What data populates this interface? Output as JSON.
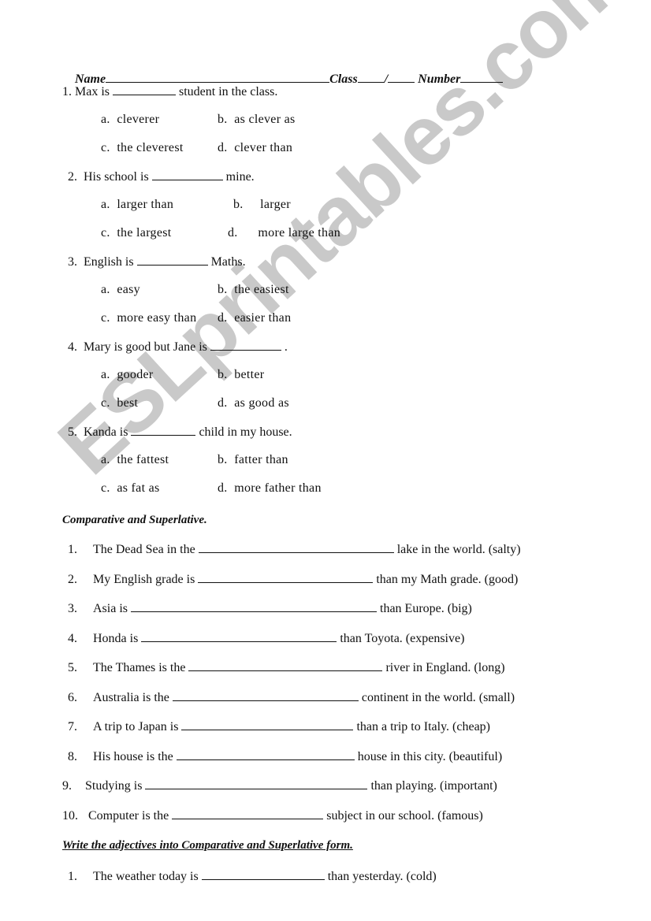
{
  "watermark": "ESLprintables.com",
  "header": {
    "name_label": "Name",
    "class_label": "Class",
    "class_separator": "/",
    "number_label": "Number"
  },
  "part1": {
    "questions": [
      {
        "num": "1.",
        "before": "Max is",
        "after": "student in the class.",
        "options": [
          {
            "letter": "a.",
            "text": "cleverer"
          },
          {
            "letter": "b.",
            "text": "as clever as"
          },
          {
            "letter": "c.",
            "text": "the cleverest"
          },
          {
            "letter": "d.",
            "text": "clever than"
          }
        ]
      },
      {
        "num": "2.",
        "before": "His school is",
        "after": "mine.",
        "options": [
          {
            "letter": "a.",
            "text": "larger than"
          },
          {
            "letter": "b.",
            "text": "larger"
          },
          {
            "letter": "c.",
            "text": "the largest"
          },
          {
            "letter": "d.",
            "text": "more large than"
          }
        ]
      },
      {
        "num": "3.",
        "before": "English is",
        "after": "Maths.",
        "options": [
          {
            "letter": "a.",
            "text": "easy"
          },
          {
            "letter": "b.",
            "text": "the easiest"
          },
          {
            "letter": "c.",
            "text": "more easy than"
          },
          {
            "letter": "d.",
            "text": "easier than"
          }
        ]
      },
      {
        "num": "4.",
        "before": "Mary is good but Jane is",
        "after": ".",
        "options": [
          {
            "letter": "a.",
            "text": "gooder"
          },
          {
            "letter": "b.",
            "text": "better"
          },
          {
            "letter": "c.",
            "text": "best"
          },
          {
            "letter": "d.",
            "text": "as good as"
          }
        ]
      },
      {
        "num": "5.",
        "before": "Kanda is",
        "after": "child in my house.",
        "options": [
          {
            "letter": "a.",
            "text": "the fattest"
          },
          {
            "letter": "b.",
            "text": "fatter than"
          },
          {
            "letter": "c.",
            "text": "as fat as"
          },
          {
            "letter": "d.",
            "text": "more father than"
          }
        ]
      }
    ]
  },
  "part2": {
    "title": "Comparative and Superlative.",
    "items": [
      {
        "num": "1.",
        "before": "The Dead Sea in the",
        "after": "lake in the world. (salty)"
      },
      {
        "num": "2.",
        "before": "My English grade is",
        "after": "than my Math grade. (good)"
      },
      {
        "num": "3.",
        "before": "Asia is",
        "after": "than Europe. (big)"
      },
      {
        "num": "4.",
        "before": "Honda is",
        "after": "than Toyota. (expensive)"
      },
      {
        "num": "5.",
        "before": "The Thames is the",
        "after": "river in England. (long)"
      },
      {
        "num": "6.",
        "before": "Australia is the",
        "after": "continent in the world. (small)"
      },
      {
        "num": "7.",
        "before": "A trip to Japan is",
        "after": "than a trip to Italy. (cheap)"
      },
      {
        "num": "8.",
        "before": "His house is the",
        "after": "house in this city. (beautiful)"
      },
      {
        "num": "9.",
        "before": "Studying is",
        "after": "than playing. (important)"
      },
      {
        "num": "10.",
        "before": "Computer is the",
        "after": "subject in our school. (famous)"
      }
    ]
  },
  "part3": {
    "title": "Write the adjectives into Comparative and Superlative form.",
    "items": [
      {
        "num": "1.",
        "before": "The weather today is",
        "after": "than yesterday. (cold)"
      }
    ]
  }
}
